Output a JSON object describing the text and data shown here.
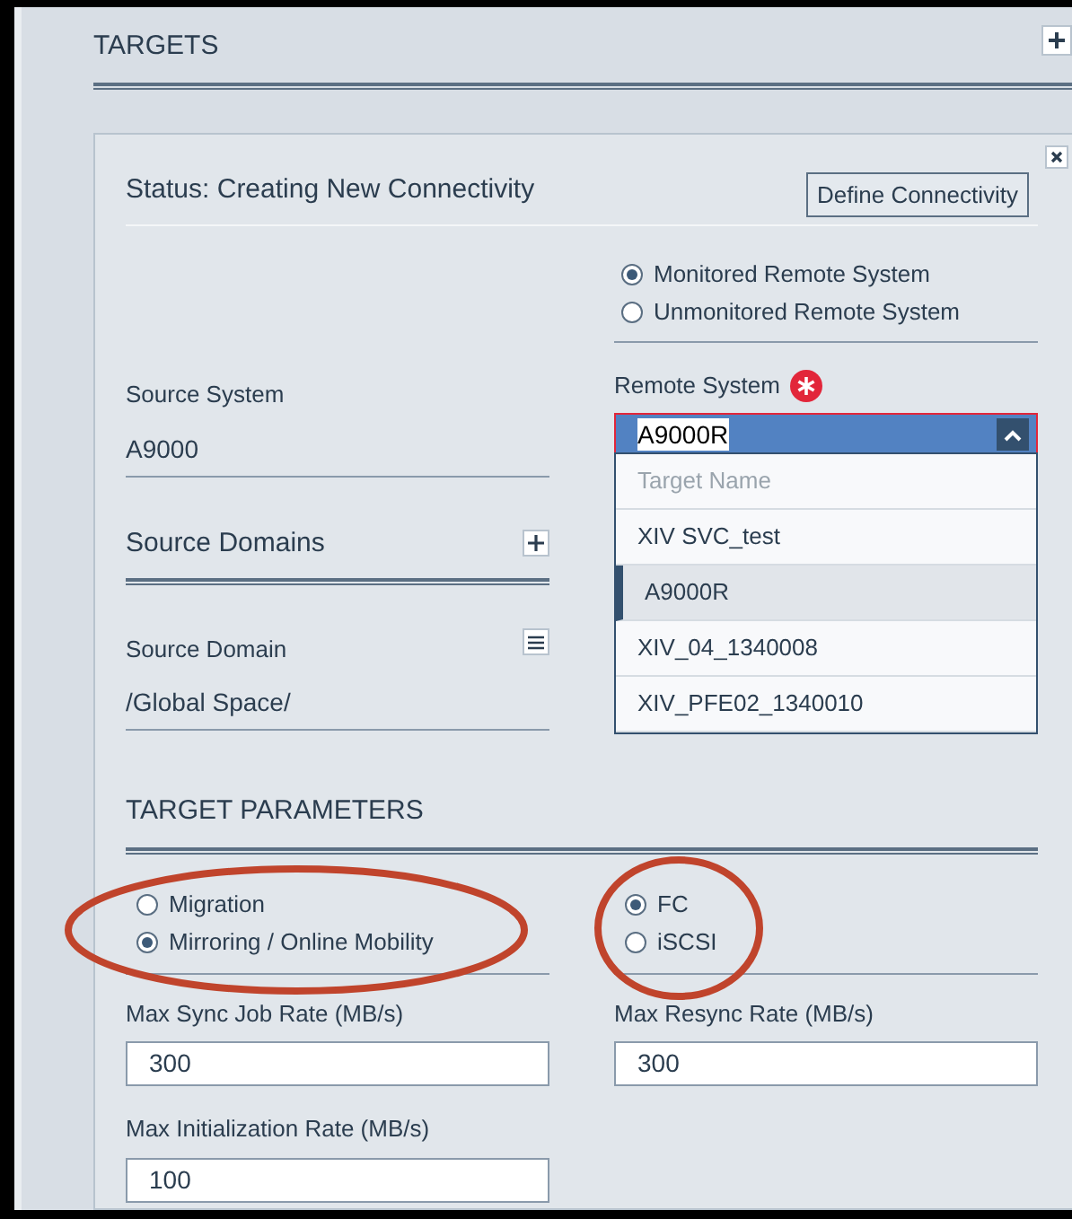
{
  "section": {
    "title": "TARGETS"
  },
  "card": {
    "status": "Status: Creating New Connectivity",
    "define_button": "Define Connectivity",
    "monitoring_options": [
      {
        "label": "Monitored Remote System",
        "selected": true
      },
      {
        "label": "Unmonitored Remote System",
        "selected": false
      }
    ],
    "source_system": {
      "label": "Source System",
      "value": "A9000"
    },
    "remote_system": {
      "label": "Remote System",
      "required": true,
      "value": "A9000R"
    },
    "dropdown": {
      "expanded": true,
      "header": "Target Name",
      "items": [
        {
          "label": "XIV SVC_test",
          "selected": false
        },
        {
          "label": "A9000R",
          "selected": true
        },
        {
          "label": "XIV_04_1340008",
          "selected": false
        },
        {
          "label": "XIV_PFE02_1340010",
          "selected": false
        }
      ]
    },
    "source_domains": {
      "title": "Source Domains"
    },
    "source_domain": {
      "label": "Source Domain",
      "value": "/Global Space/"
    },
    "target_parameters": {
      "title": "TARGET PARAMETERS",
      "mode_options": [
        {
          "label": "Migration",
          "selected": false
        },
        {
          "label": "Mirroring / Online Mobility",
          "selected": true
        }
      ],
      "protocol_options": [
        {
          "label": "FC",
          "selected": true
        },
        {
          "label": "iSCSI",
          "selected": false
        }
      ],
      "fields": [
        {
          "label": "Max Sync Job Rate (MB/s)",
          "value": "300"
        },
        {
          "label": "Max Resync Rate (MB/s)",
          "value": "300"
        },
        {
          "label": "Max Initialization Rate (MB/s)",
          "value": "100"
        }
      ]
    }
  }
}
